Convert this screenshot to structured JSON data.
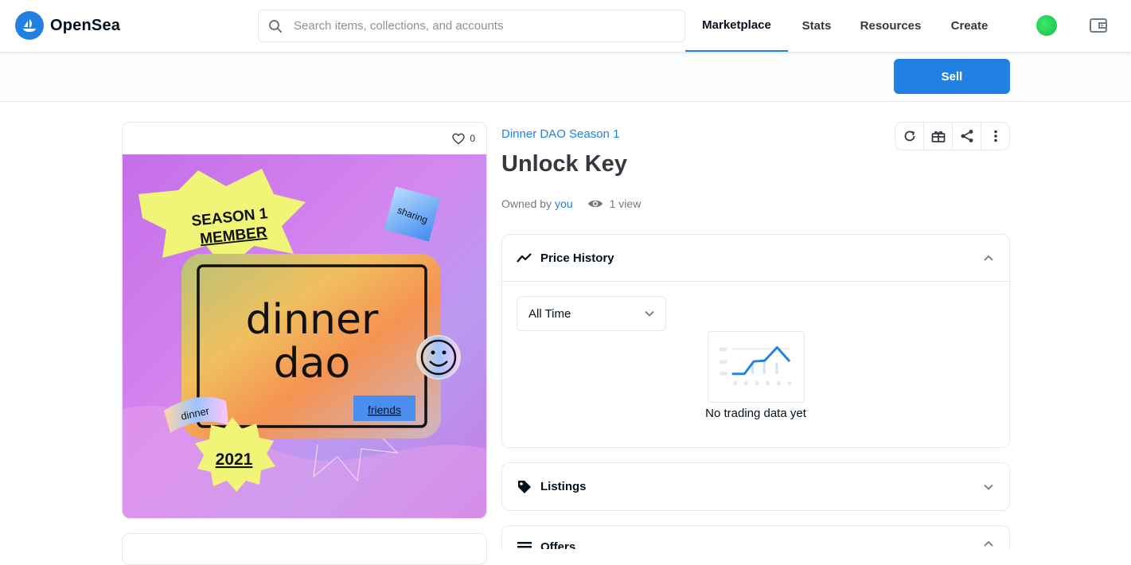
{
  "header": {
    "brand": "OpenSea",
    "search_placeholder": "Search items, collections, and accounts",
    "nav": [
      {
        "label": "Marketplace",
        "active": true
      },
      {
        "label": "Stats"
      },
      {
        "label": "Resources"
      },
      {
        "label": "Create"
      }
    ],
    "accent_color": "#2081e2"
  },
  "subbar": {
    "sell_label": "Sell"
  },
  "asset": {
    "favorites": "0",
    "art_text": {
      "badge": "SEASON 1 MEMBER",
      "badge_line1": "SEASON 1",
      "badge_line2": "MEMBER",
      "main_line1": "dinner",
      "main_line2": "dao",
      "sticker_sharing": "sharing",
      "sticker_friends": "friends",
      "sticker_dinner": "dinner",
      "year": "2021"
    }
  },
  "details": {
    "collection": "Dinner DAO Season 1",
    "title": "Unlock Key",
    "owned_by_label": "Owned by",
    "owner": "you",
    "views": "1 view"
  },
  "panels": {
    "price_history": {
      "title": "Price History",
      "range": "All Time",
      "empty": "No trading data yet"
    },
    "listings": {
      "title": "Listings"
    },
    "offers": {
      "title": "Offers"
    }
  }
}
